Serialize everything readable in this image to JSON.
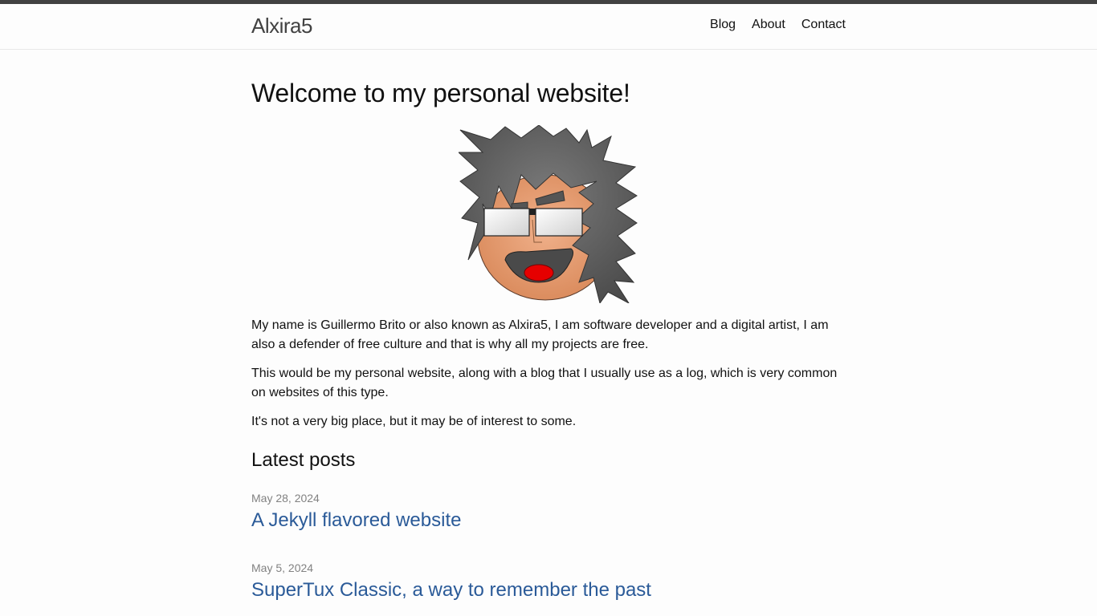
{
  "header": {
    "site_title": "Alxira5",
    "nav": [
      "Blog",
      "About",
      "Contact"
    ]
  },
  "main": {
    "title": "Welcome to my personal website!",
    "paragraphs": [
      "My name is Guillermo Brito or also known as Alxira5, I am software developer and a digital artist, I am also a defender of free culture and that is why all my projects are free.",
      "This would be my personal website, along with a blog that I usually use as a log, which is very common on websites of this type.",
      "It's not a very big place, but it may be of interest to some."
    ],
    "latest_posts_heading": "Latest posts",
    "posts": [
      {
        "date": "May 28, 2024",
        "title": "A Jekyll flavored website"
      },
      {
        "date": "May 5, 2024",
        "title": "SuperTux Classic, a way to remember the past"
      }
    ]
  },
  "colors": {
    "accent_bar": "#424242",
    "link": "#2a5a98",
    "meta": "#828282"
  },
  "icons": {
    "avatar": "cartoon-face-spiky-hair-glasses"
  }
}
